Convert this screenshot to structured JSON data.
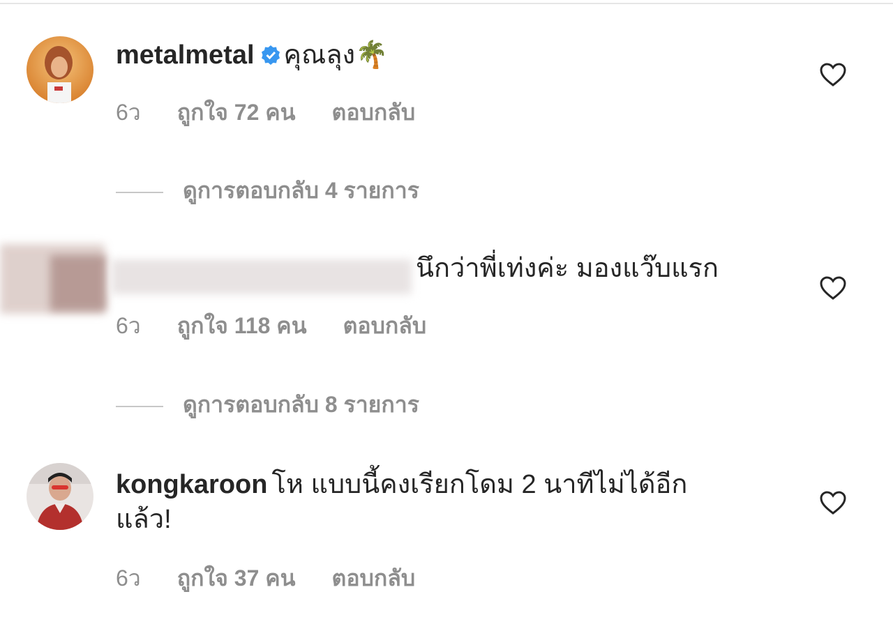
{
  "comments": [
    {
      "username": "metalmetal",
      "verified": true,
      "text": "คุณลุง",
      "emoji": "🌴",
      "time": "6ว",
      "likes": "ถูกใจ 72 คน",
      "reply_label": "ตอบกลับ",
      "view_replies": "ดูการตอบกลับ 4 รายการ"
    },
    {
      "username": "",
      "text": "นึกว่าพี่เท่งค่ะ มองแว๊บแรก",
      "time": "6ว",
      "likes": "ถูกใจ 118 คน",
      "reply_label": "ตอบกลับ",
      "view_replies": "ดูการตอบกลับ 8 รายการ"
    },
    {
      "username": "kongkaroon",
      "text": "โห แบบนี้คงเรียกโดม 2 นาทีไม่ได้อีก",
      "text_line2": "แล้ว!",
      "time": "6ว",
      "likes": "ถูกใจ 37 คน",
      "reply_label": "ตอบกลับ"
    }
  ],
  "icons": {
    "like": "heart-outline-icon",
    "verified": "verified-badge-icon"
  },
  "colors": {
    "verified_blue": "#3897f0",
    "meta_gray": "#8e8e8e"
  }
}
